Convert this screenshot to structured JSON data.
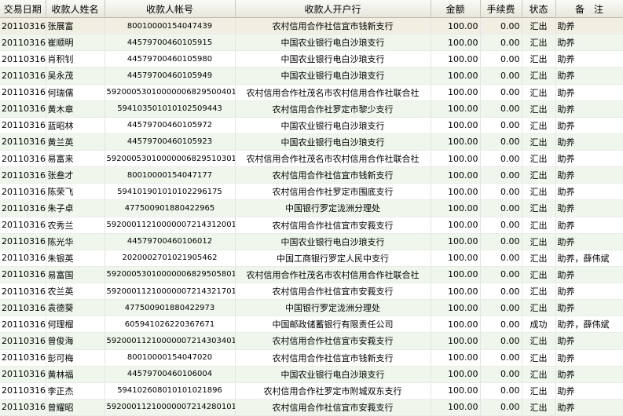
{
  "columns": [
    "交易日期",
    "收款人姓名",
    "收款人帐号",
    "收款人开户行",
    "金额",
    "手续费",
    "状态",
    "备　注"
  ],
  "rows": [
    [
      "20110316",
      "张展富",
      "80010000154047439",
      "农村信用合作社信宜市钱新支行",
      "100.00",
      "0.00",
      "汇出",
      "助养"
    ],
    [
      "20110316",
      "崔顺明",
      "44579700460105915",
      "中国农业银行电白沙琅支行",
      "100.00",
      "0.00",
      "汇出",
      "助养"
    ],
    [
      "20110316",
      "肖积钊",
      "44579700460105980",
      "中国农业银行电白沙琅支行",
      "100.00",
      "0.00",
      "汇出",
      "助养"
    ],
    [
      "20110316",
      "吴永茂",
      "44579700460105949",
      "中国农业银行电白沙琅支行",
      "100.00",
      "0.00",
      "汇出",
      "助养"
    ],
    [
      "20110316",
      "何瑞儒",
      "592000530100000068295004011",
      "农村信用合作社茂名市农村信用合作社联合社",
      "100.00",
      "0.00",
      "汇出",
      "助养"
    ],
    [
      "20110316",
      "黄木章",
      "59410350101010250 9443",
      "农村信用合作社罗定市黎少支行",
      "100.00",
      "0.00",
      "汇出",
      "助养"
    ],
    [
      "20110316",
      "蓝昭林",
      "44579700460105972",
      "中国农业银行电白沙琅支行",
      "100.00",
      "0.00",
      "汇出",
      "助养"
    ],
    [
      "20110316",
      "黄兰英",
      "44579700460105923",
      "中国农业银行电白沙琅支行",
      "100.00",
      "0.00",
      "汇出",
      "助养"
    ],
    [
      "20110316",
      "易富来",
      "592000530100000068295103011",
      "农村信用合作社茂名市农村信用合作社联合社",
      "100.00",
      "0.00",
      "汇出",
      "助养"
    ],
    [
      "20110316",
      "张叁才",
      "80010000154047177",
      "农村信用合作社信宜市钱新支行",
      "100.00",
      "0.00",
      "汇出",
      "助养"
    ],
    [
      "20110316",
      "陈荣飞",
      "59410190101010229 6175",
      "农村信用合作社罗定市围底支行",
      "100.00",
      "0.00",
      "汇出",
      "助养"
    ],
    [
      "20110316",
      "朱子卓",
      "477500901880422965",
      "中国银行罗定泷洲分理处",
      "100.00",
      "0.00",
      "汇出",
      "助养"
    ],
    [
      "20110316",
      "农秀兰",
      "592000112100000072143120011",
      "农村信用合作社信宜市安莪支行",
      "100.00",
      "0.00",
      "汇出",
      "助养"
    ],
    [
      "20110316",
      "陈光华",
      "44579700460106012",
      "中国农业银行电白沙琅支行",
      "100.00",
      "0.00",
      "汇出",
      "助养"
    ],
    [
      "20110316",
      "朱银英",
      "2020002701021905462",
      "中国工商银行罗定人民中支行",
      "100.00",
      "0.00",
      "汇出",
      "助养，薛伟斌"
    ],
    [
      "20110316",
      "易富国",
      "592000530100000068295058011",
      "农村信用合作社茂名市农村信用合作社联合社",
      "100.00",
      "0.00",
      "汇出",
      "助养"
    ],
    [
      "20110316",
      "农兰英",
      "592000112100000072143217011",
      "农村信用合作社信宜市安莪支行",
      "100.00",
      "0.00",
      "汇出",
      "助养"
    ],
    [
      "20110316",
      "袁德葵",
      "477500901880422973",
      "中国银行罗定泷洲分理处",
      "100.00",
      "0.00",
      "汇出",
      "助养"
    ],
    [
      "20110316",
      "何理榴",
      "605941026220367671",
      "中国邮政储蓄银行有限责任公司",
      "100.00",
      "0.00",
      "成功",
      "助养，薛伟斌"
    ],
    [
      "20110316",
      "曾俊海",
      "592000112100000072143034011",
      "农村信用合作社信宜市安莪支行",
      "100.00",
      "0.00",
      "汇出",
      "助养"
    ],
    [
      "20110316",
      "彭可梅",
      "80010000154047020",
      "农村信用合作社信宜市钱新支行",
      "100.00",
      "0.00",
      "汇出",
      "助养"
    ],
    [
      "20110316",
      "黄林福",
      "44579700460106004",
      "中国农业银行电白沙琅支行",
      "100.00",
      "0.00",
      "汇出",
      "助养"
    ],
    [
      "20110316",
      "李正杰",
      "59410260801010102 1896",
      "农村信用合作社罗定市附城双东支行",
      "100.00",
      "0.00",
      "汇出",
      "助养"
    ],
    [
      "20110316",
      "曾耀昭",
      "592000112100000072142801011",
      "农村信用合作社信宜市安莪支行",
      "100.00",
      "0.00",
      "汇出",
      "助养"
    ]
  ]
}
